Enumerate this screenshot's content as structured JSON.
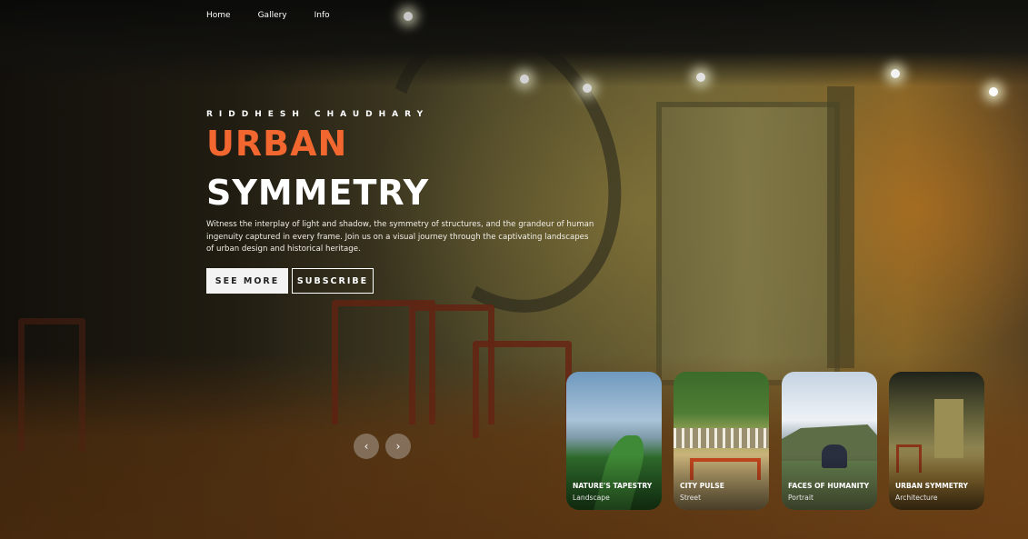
{
  "nav": {
    "items": [
      {
        "label": "Home"
      },
      {
        "label": "Gallery"
      },
      {
        "label": "Info"
      }
    ]
  },
  "hero": {
    "author": "RIDDHESH CHAUDHARY",
    "title_line1": "URBAN",
    "title_line2": "SYMMETRY",
    "description": "Witness the interplay of light and shadow, the symmetry of structures, and the grandeur of human ingenuity captured in every frame. Join us on a visual journey through the captivating landscapes of urban design and historical heritage.",
    "see_more_label": "SEE MORE",
    "subscribe_label": "SUBSCRIBE",
    "accent_color": "#f2672f"
  },
  "carousel": {
    "prev_icon": "chevron-left-icon",
    "next_icon": "chevron-right-icon",
    "prev_glyph": "‹",
    "next_glyph": "›",
    "cards": [
      {
        "title": "NATURE'S TAPESTRY",
        "category": "Landscape"
      },
      {
        "title": "CITY PULSE",
        "category": "Street"
      },
      {
        "title": "FACES OF HUMANITY",
        "category": "Portrait"
      },
      {
        "title": "URBAN SYMMETRY",
        "category": "Architecture"
      }
    ]
  }
}
